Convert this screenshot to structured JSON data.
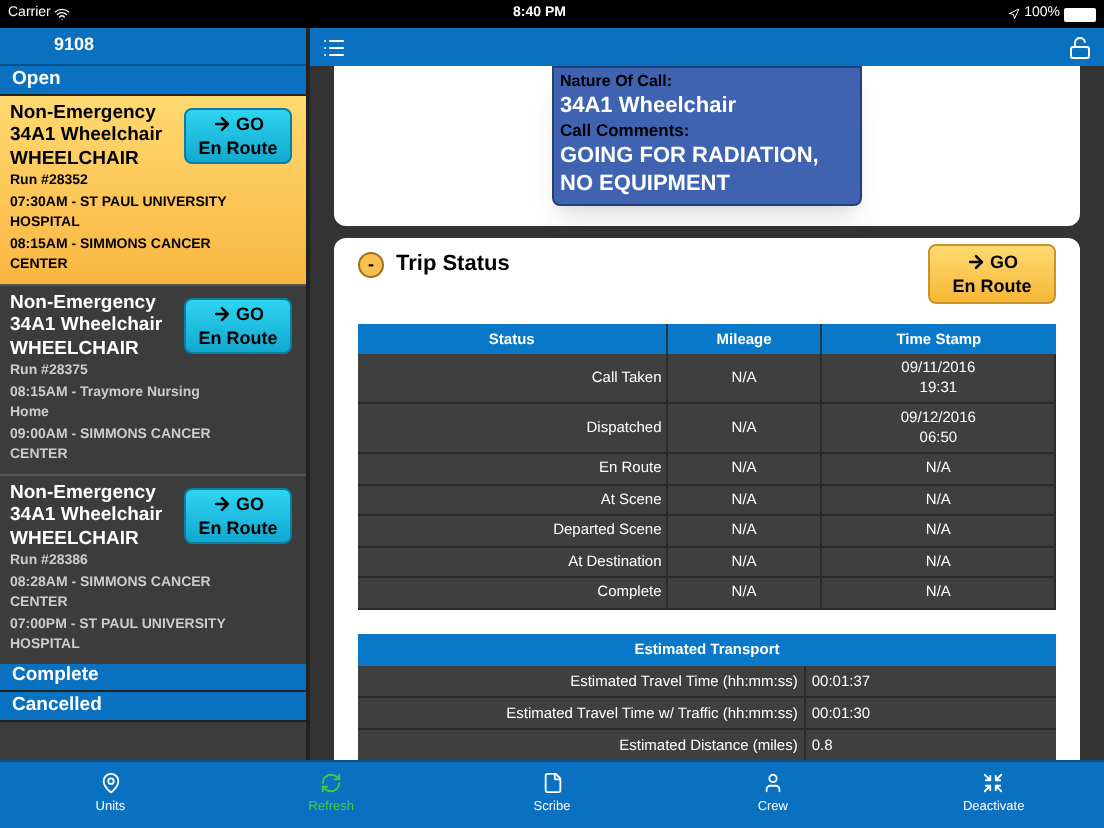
{
  "status_bar": {
    "carrier": "Carrier",
    "time": "8:40 PM",
    "battery": "100%"
  },
  "sidebar": {
    "title": "9108",
    "sections": [
      {
        "label": "Open",
        "trips": [
          {
            "type": "Non-Emergency",
            "nature": "34A1 Wheelchair",
            "mode": "WHEELCHAIR",
            "run": "Run #28352",
            "pickup": "07:30AM - ST PAUL UNIVERSITY HOSPITAL",
            "dropoff": "08:15AM - SIMMONS CANCER CENTER",
            "selected": true,
            "button": {
              "top": "GO",
              "bottom": "En Route"
            }
          },
          {
            "type": "Non-Emergency",
            "nature": "34A1 Wheelchair",
            "mode": "WHEELCHAIR",
            "run": "Run #28375",
            "pickup": "08:15AM - Traymore Nursing Home",
            "dropoff": "09:00AM - SIMMONS CANCER CENTER",
            "selected": false,
            "button": {
              "top": "GO",
              "bottom": "En Route"
            }
          },
          {
            "type": "Non-Emergency",
            "nature": "34A1 Wheelchair",
            "mode": "WHEELCHAIR",
            "run": "Run #28386",
            "pickup": "08:28AM - SIMMONS CANCER CENTER",
            "dropoff": "07:00PM - ST PAUL UNIVERSITY HOSPITAL",
            "selected": false,
            "button": {
              "top": "GO",
              "bottom": "En Route"
            }
          }
        ]
      },
      {
        "label": "Complete"
      },
      {
        "label": "Cancelled"
      }
    ]
  },
  "popover": {
    "nature_label": "Nature Of Call:",
    "nature": "34A1 Wheelchair",
    "comments_label": "Call Comments:",
    "comments": "GOING FOR RADIATION, NO EQUIPMENT"
  },
  "trip_status": {
    "collapse": "-",
    "title": "Trip Status",
    "button": {
      "top": "GO",
      "bottom": "En Route"
    },
    "table": {
      "columns": [
        "Status",
        "Mileage",
        "Time Stamp"
      ],
      "rows": [
        [
          "Call Taken",
          "N/A",
          "09/11/2016\n19:31"
        ],
        [
          "Dispatched",
          "N/A",
          "09/12/2016\n06:50"
        ],
        [
          "En Route",
          "N/A",
          "N/A"
        ],
        [
          "At Scene",
          "N/A",
          "N/A"
        ],
        [
          "Departed Scene",
          "N/A",
          "N/A"
        ],
        [
          "At Destination",
          "N/A",
          "N/A"
        ],
        [
          "Complete",
          "N/A",
          "N/A"
        ]
      ]
    },
    "estimate": {
      "title": "Estimated Transport",
      "rows": [
        [
          "Estimated Travel Time (hh:mm:ss)",
          "00:01:37"
        ],
        [
          "Estimated Travel Time w/ Traffic (hh:mm:ss)",
          "00:01:30"
        ],
        [
          "Estimated Distance (miles)",
          "0.8"
        ]
      ]
    }
  },
  "tab_bar": [
    {
      "label": "Units",
      "selected": false
    },
    {
      "label": "Refresh",
      "selected": true
    },
    {
      "label": "Scribe",
      "selected": false
    },
    {
      "label": "Crew",
      "selected": false
    },
    {
      "label": "Deactivate",
      "selected": false
    }
  ]
}
